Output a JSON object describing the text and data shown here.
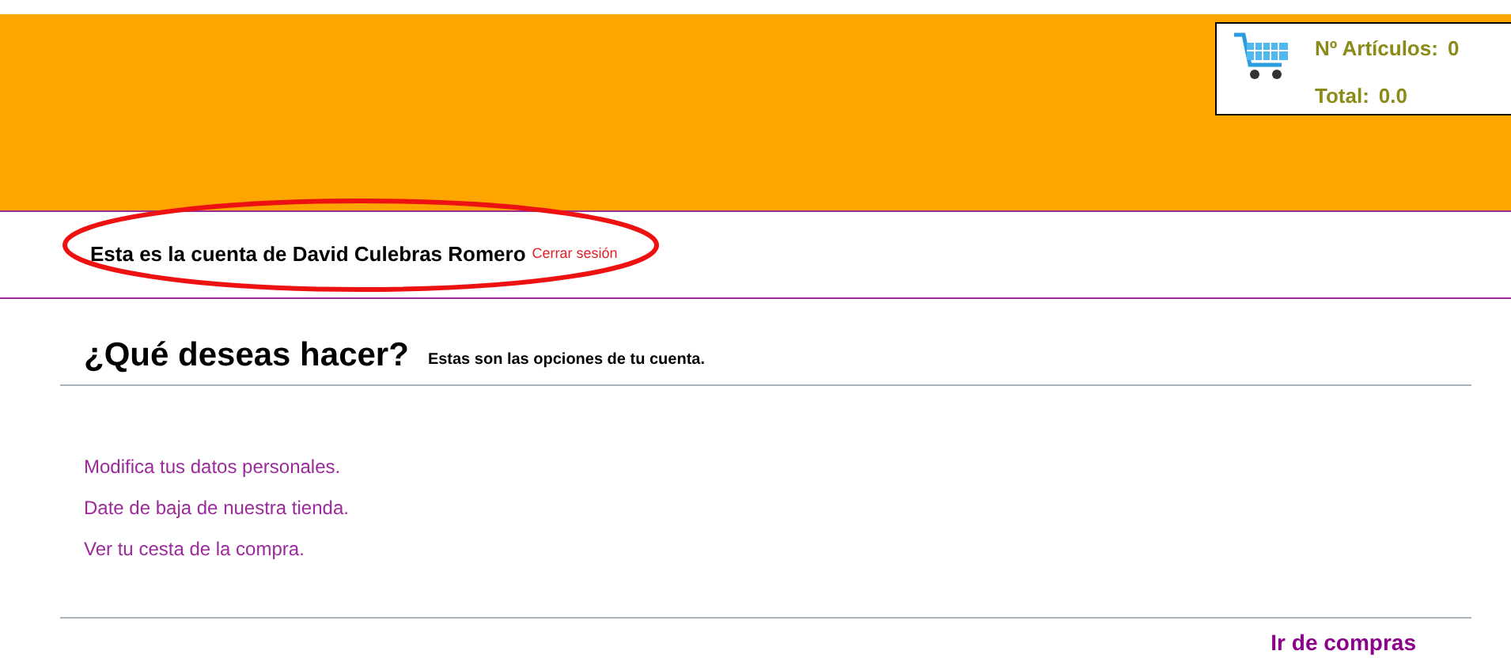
{
  "cart": {
    "items_label": "Nº Artículos:",
    "items_value": "0",
    "total_label": "Total:",
    "total_value": "0.0"
  },
  "account": {
    "text": "Esta es la cuenta de David Culebras Romero",
    "logout": "Cerrar sesión"
  },
  "section": {
    "title": "¿Qué deseas hacer?",
    "subtitle": "Estas son las opciones de tu cuenta."
  },
  "options": [
    "Modifica tus datos personales.",
    "Date de baja de nuestra tienda.",
    "Ver tu cesta de la compra."
  ],
  "footer_link": "Ir de compras"
}
